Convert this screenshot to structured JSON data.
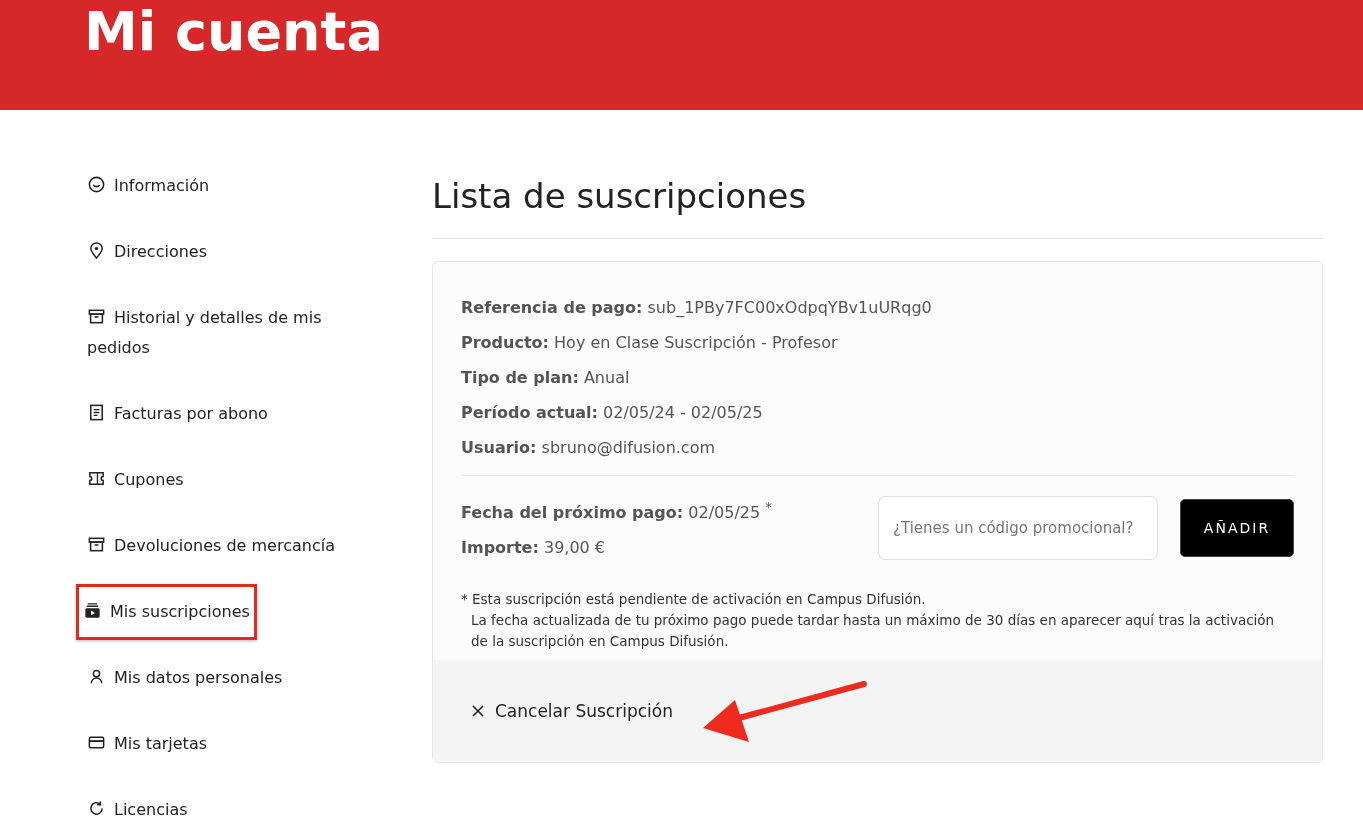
{
  "header": {
    "title": "Mi cuenta"
  },
  "sidebar": {
    "items": [
      {
        "label": "Información",
        "kind": "smile",
        "highlighted": false
      },
      {
        "label": "Direcciones",
        "kind": "pin",
        "highlighted": false
      },
      {
        "label": "Historial y detalles de mis pedidos",
        "kind": "archive",
        "highlighted": false
      },
      {
        "label": "Facturas por abono",
        "kind": "document",
        "highlighted": false
      },
      {
        "label": "Cupones",
        "kind": "ticket",
        "highlighted": false
      },
      {
        "label": "Devoluciones de mercancía",
        "kind": "archive",
        "highlighted": false
      },
      {
        "label": "Mis suscripciones",
        "kind": "subscription",
        "highlighted": true
      },
      {
        "label": "Mis datos personales",
        "kind": "user",
        "highlighted": false
      },
      {
        "label": "Mis tarjetas",
        "kind": "card",
        "highlighted": false
      },
      {
        "label": "Licencias",
        "kind": "refresh",
        "highlighted": false
      }
    ]
  },
  "page_title": "Lista de suscripciones",
  "subscription": {
    "details": [
      {
        "label": "Referencia de pago:",
        "value": "sub_1PBy7FC00xOdpqYBv1uURqg0"
      },
      {
        "label": "Producto:",
        "value": "Hoy en Clase Suscripción - Profesor"
      },
      {
        "label": "Tipo de plan:",
        "value": "Anual"
      },
      {
        "label": "Período actual:",
        "value": "02/05/24 - 02/05/25"
      },
      {
        "label": "Usuario:",
        "value": "sbruno@difusion.com"
      }
    ],
    "payment": [
      {
        "label": "Fecha del próximo pago:",
        "value": "02/05/25 $^{*}$"
      },
      {
        "label": "Importe:",
        "value": "39,00 €"
      }
    ],
    "promo_field": {
      "placeholder": "¿Tienes un código promocional?"
    },
    "add_button": "AÑADIR",
    "footnote": [
      "* Esta suscripción está pendiente de activación en Campus Difusión.",
      "La fecha actualizada de tu próximo pago puede tardar hasta un máximo de 30 días en aparecer aquí tras la activación de la suscripción en Campus Difusión."
    ],
    "cancel_button": "Cancelar Suscripción"
  },
  "annotation_arrow": true
}
